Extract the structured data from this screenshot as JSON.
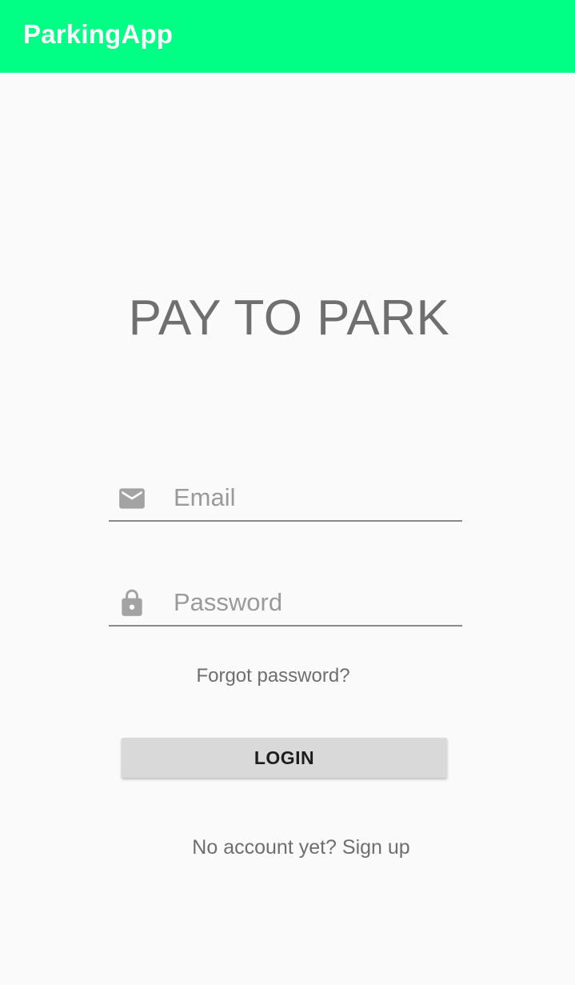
{
  "app_bar": {
    "title": "ParkingApp",
    "color": "#00ff84"
  },
  "main": {
    "title": "PAY TO PARK",
    "email_field": {
      "icon": "mail-icon",
      "placeholder": "Email",
      "value": ""
    },
    "password_field": {
      "icon": "lock-icon",
      "placeholder": "Password",
      "value": ""
    },
    "forgot_password_label": "Forgot password?",
    "login_label": "LOGIN",
    "signup_label": "No account yet? Sign up"
  }
}
